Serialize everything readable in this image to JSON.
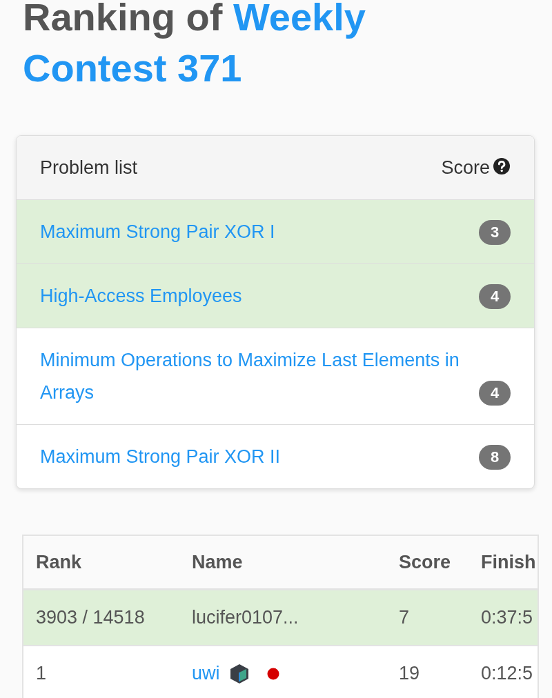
{
  "heading": {
    "prefix": "Ranking of",
    "contest": "Weekly Contest 371"
  },
  "problem_list": {
    "title": "Problem list",
    "score_label": "Score",
    "problems": [
      {
        "title": "Maximum Strong Pair XOR I",
        "score": "3",
        "solved": true
      },
      {
        "title": "High-Access Employees",
        "score": "4",
        "solved": true
      },
      {
        "title": "Minimum Operations to Maximize Last Elements in Arrays",
        "score": "4",
        "solved": false
      },
      {
        "title": "Maximum Strong Pair XOR II",
        "score": "8",
        "solved": false
      }
    ]
  },
  "ranking": {
    "columns": [
      "Rank",
      "Name",
      "Score",
      "Finish"
    ],
    "rows": [
      {
        "rank": "3903 / 14518",
        "name": "lucifer0107...",
        "score": "7",
        "finish": "0:37:5",
        "is_self": true,
        "kind": "text"
      },
      {
        "rank": "1",
        "name": "uwi",
        "score": "19",
        "finish": "0:12:5",
        "is_self": false,
        "kind": "link"
      }
    ]
  }
}
